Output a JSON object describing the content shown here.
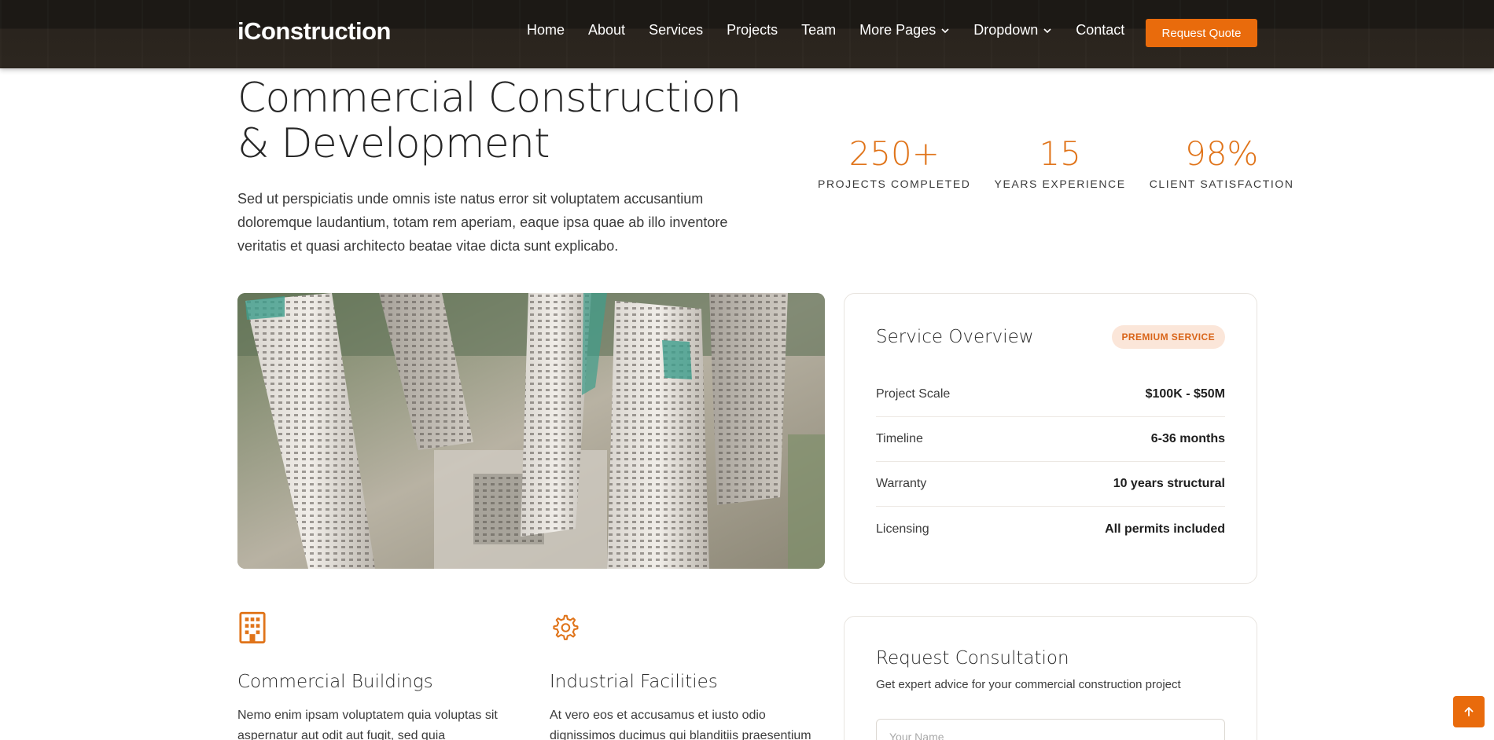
{
  "header": {
    "logo": "iConstruction",
    "nav": [
      {
        "label": "Home",
        "dropdown": false
      },
      {
        "label": "About",
        "dropdown": false
      },
      {
        "label": "Services",
        "dropdown": false
      },
      {
        "label": "Projects",
        "dropdown": false
      },
      {
        "label": "Team",
        "dropdown": false
      },
      {
        "label": "More Pages",
        "dropdown": true
      },
      {
        "label": "Dropdown",
        "dropdown": true
      },
      {
        "label": "Contact",
        "dropdown": false
      }
    ],
    "cta_label": "Request Quote"
  },
  "hero": {
    "title": "Commercial Construction & Development",
    "description": "Sed ut perspiciatis unde omnis iste natus error sit voluptatem accusantium doloremque laudantium, totam rem aperiam, eaque ipsa quae ab illo inventore veritatis et quasi architecto beatae vitae dicta sunt explicabo."
  },
  "stats": [
    {
      "value": "250+",
      "label": "PROJECTS COMPLETED"
    },
    {
      "value": "15",
      "label": "YEARS EXPERIENCE"
    },
    {
      "value": "98%",
      "label": "CLIENT SATISFACTION"
    }
  ],
  "overview": {
    "title": "Service Overview",
    "badge": "PREMIUM SERVICE",
    "rows": [
      {
        "label": "Project Scale",
        "value": "$100K - $50M"
      },
      {
        "label": "Timeline",
        "value": "6-36 months"
      },
      {
        "label": "Warranty",
        "value": "10 years structural"
      },
      {
        "label": "Licensing",
        "value": "All permits included"
      }
    ]
  },
  "features": [
    {
      "icon": "building-icon",
      "title": "Commercial Buildings",
      "text": "Nemo enim ipsam voluptatem quia voluptas sit aspernatur aut odit aut fugit, sed quia"
    },
    {
      "icon": "gear-icon",
      "title": "Industrial Facilities",
      "text": "At vero eos et accusamus et iusto odio dignissimos ducimus qui blanditiis praesentium"
    }
  ],
  "consultation": {
    "title": "Request Consultation",
    "subtitle": "Get expert advice for your commercial construction project",
    "name_placeholder": "Your Name"
  },
  "colors": {
    "accent": "#e96b0c",
    "header_bg": "#1c1915",
    "badge_bg": "#fbe6d9"
  }
}
